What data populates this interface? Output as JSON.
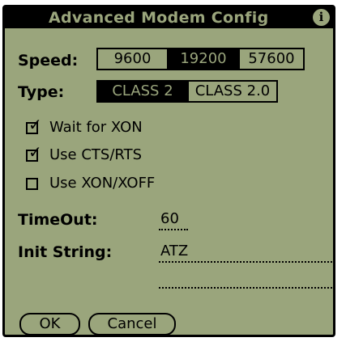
{
  "dialog": {
    "title": "Advanced Modem Config",
    "info_icon": "info-icon"
  },
  "speed": {
    "label": "Speed:",
    "options": [
      "9600",
      "19200",
      "57600"
    ],
    "selected": "19200"
  },
  "type": {
    "label": "Type:",
    "options": [
      "CLASS 2",
      "CLASS 2.0"
    ],
    "selected": "CLASS 2"
  },
  "checkboxes": [
    {
      "label": "Wait for XON",
      "checked": true
    },
    {
      "label": "Use CTS/RTS",
      "checked": true
    },
    {
      "label": "Use XON/XOFF",
      "checked": false
    }
  ],
  "timeout": {
    "label": "TimeOut:",
    "value": "60"
  },
  "init_string": {
    "label": "Init String:",
    "value": "ATZ",
    "value2": ""
  },
  "buttons": {
    "ok": "OK",
    "cancel": "Cancel"
  },
  "colors": {
    "screen": "#9aa57c",
    "ink": "#000000"
  }
}
